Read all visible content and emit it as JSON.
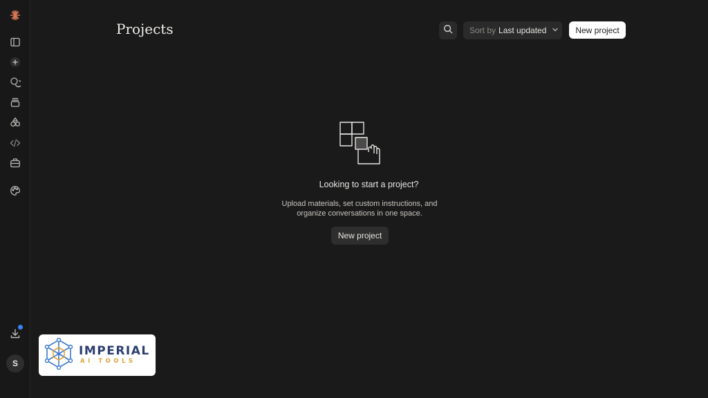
{
  "header": {
    "title": "Projects",
    "sort_prefix": "Sort by",
    "sort_value": "Last updated",
    "new_project_label": "New project"
  },
  "empty_state": {
    "title": "Looking to start a project?",
    "description": "Upload materials, set custom instructions, and organize conversations in one space.",
    "button_label": "New project"
  },
  "sidebar": {
    "icons": [
      "app-logo-icon",
      "toggle-sidebar-icon",
      "new-chat-icon",
      "chats-icon",
      "projects-icon",
      "artifacts-icon",
      "code-icon",
      "briefcase-icon",
      "palette-icon",
      "download-icon"
    ],
    "avatar_initial": "S",
    "notification_color": "#3b82f6"
  },
  "watermark": {
    "line1": "IMPERIAL",
    "line2": "AI TOOLS"
  },
  "colors": {
    "background": "#1a1a1a",
    "logo_accent": "#d97757"
  }
}
